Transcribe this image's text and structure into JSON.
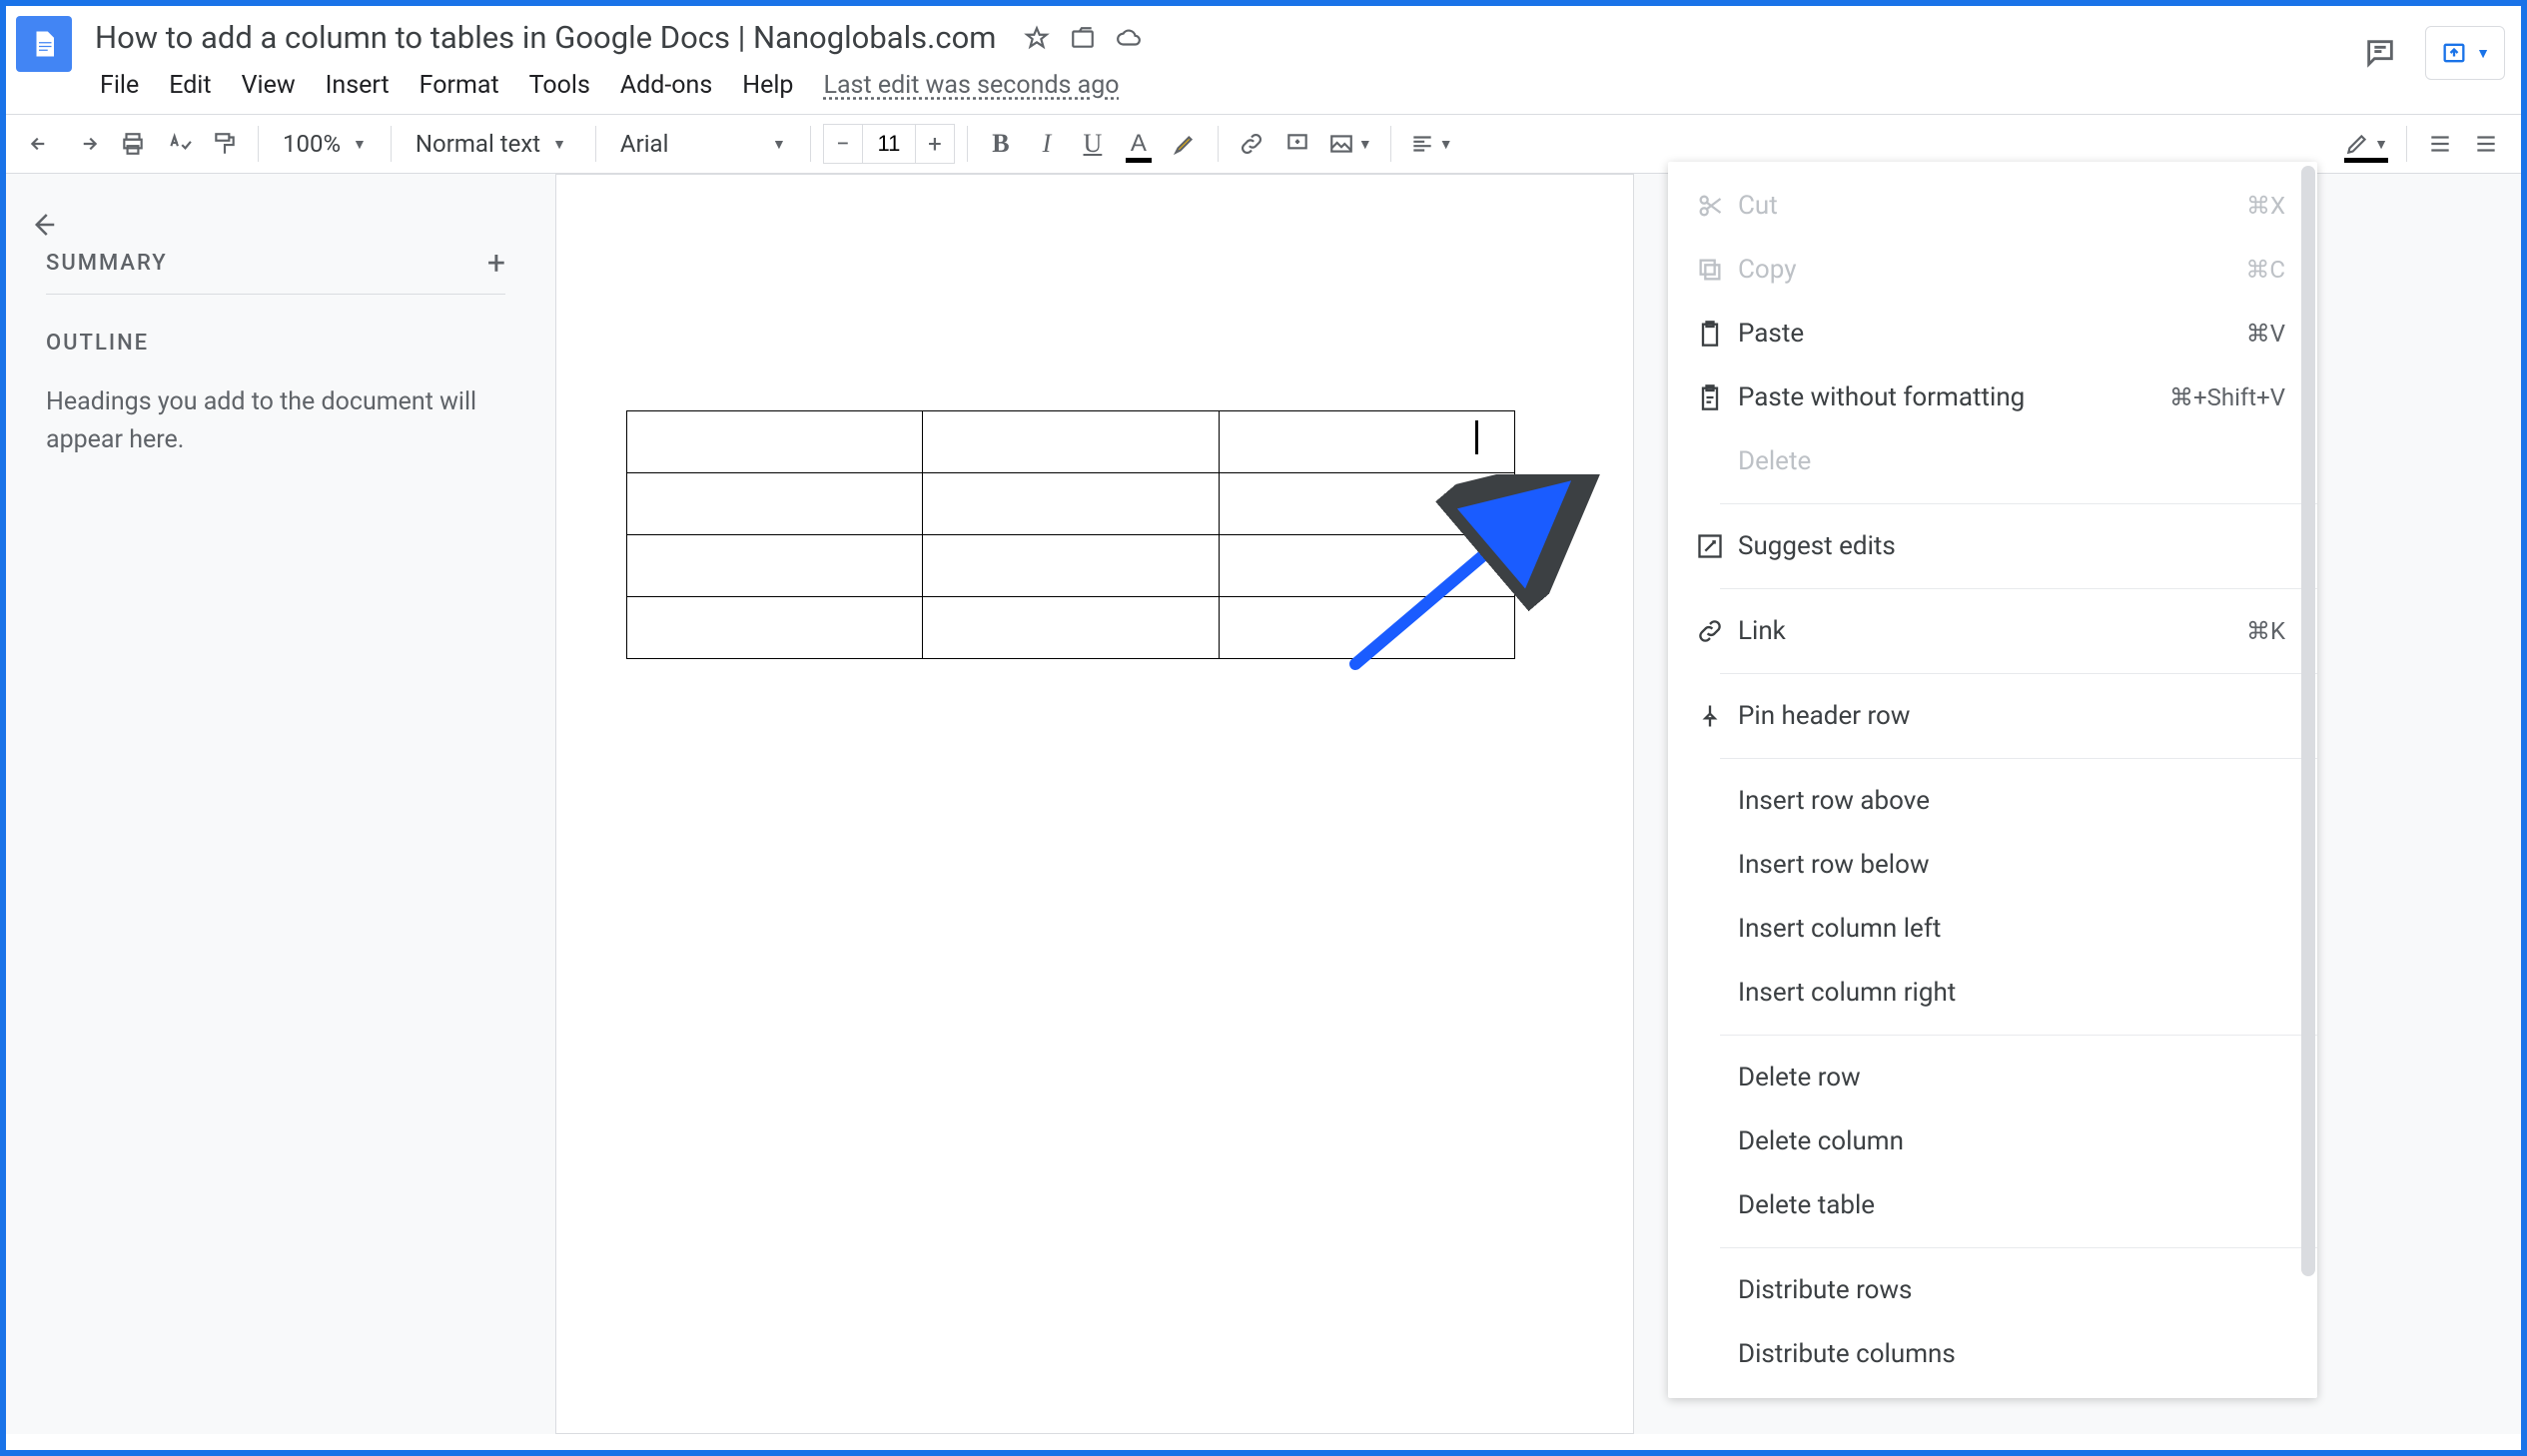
{
  "header": {
    "title": "How to add a column to tables in Google Docs | Nanoglobals.com",
    "last_edit": "Last edit was seconds ago"
  },
  "menubar": [
    "File",
    "Edit",
    "View",
    "Insert",
    "Format",
    "Tools",
    "Add-ons",
    "Help"
  ],
  "toolbar": {
    "zoom": "100%",
    "style": "Normal text",
    "font": "Arial",
    "font_size": "11"
  },
  "sidebar": {
    "summary_label": "SUMMARY",
    "outline_label": "OUTLINE",
    "outline_placeholder": "Headings you add to the document will appear here."
  },
  "table": {
    "rows": 4,
    "cols": 3
  },
  "context_menu": {
    "cut": {
      "label": "Cut",
      "shortcut": "⌘X",
      "disabled": true
    },
    "copy": {
      "label": "Copy",
      "shortcut": "⌘C",
      "disabled": true
    },
    "paste": {
      "label": "Paste",
      "shortcut": "⌘V"
    },
    "paste_plain": {
      "label": "Paste without formatting",
      "shortcut": "⌘+Shift+V"
    },
    "delete": {
      "label": "Delete",
      "disabled": true
    },
    "suggest": {
      "label": "Suggest edits"
    },
    "link": {
      "label": "Link",
      "shortcut": "⌘K"
    },
    "pin_header": {
      "label": "Pin header row"
    },
    "insert_row_above": {
      "label": "Insert row above"
    },
    "insert_row_below": {
      "label": "Insert row below"
    },
    "insert_col_left": {
      "label": "Insert column left"
    },
    "insert_col_right": {
      "label": "Insert column right"
    },
    "delete_row": {
      "label": "Delete row"
    },
    "delete_col": {
      "label": "Delete column"
    },
    "delete_table": {
      "label": "Delete table"
    },
    "dist_rows": {
      "label": "Distribute rows"
    },
    "dist_cols": {
      "label": "Distribute columns"
    }
  }
}
